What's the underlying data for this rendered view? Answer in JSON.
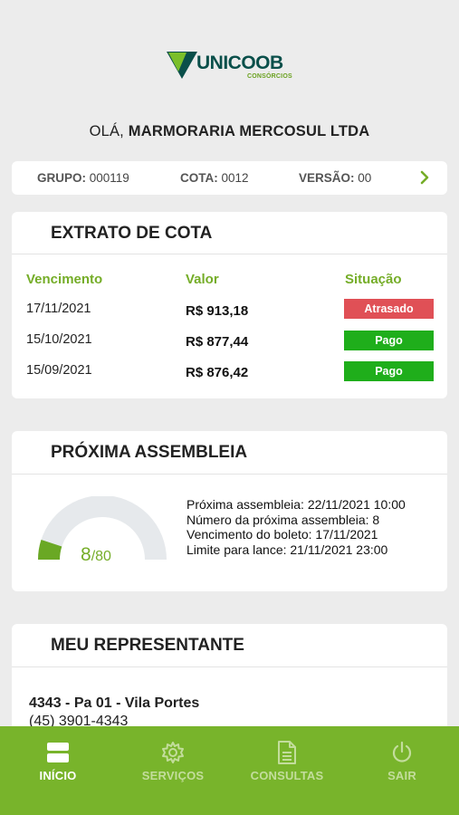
{
  "brand": {
    "name": "UNICOOB",
    "subtitle": "CONSÓRCIOS",
    "colors": {
      "primary": "#0a4f4a",
      "accent": "#78b42b"
    }
  },
  "greeting": {
    "prefix": "OLÁ,",
    "name": "MARMORARIA MERCOSUL LTDA"
  },
  "info_bar": {
    "grupo_label": "GRUPO:",
    "grupo_value": "000119",
    "cota_label": "COTA:",
    "cota_value": "0012",
    "versao_label": "VERSÃO:",
    "versao_value": "00",
    "next_icon": "chevron-right-icon"
  },
  "extrato": {
    "title": "EXTRATO DE COTA",
    "columns": [
      "Vencimento",
      "Valor",
      "Situação"
    ],
    "rows": [
      {
        "date": "17/11/2021",
        "value": "R$ 913,18",
        "status": "Atrasado",
        "status_color": "#e05056"
      },
      {
        "date": "15/10/2021",
        "value": "R$ 877,44",
        "status": "Pago",
        "status_color": "#1fae1b"
      },
      {
        "date": "15/09/2021",
        "value": "R$ 876,42",
        "status": "Pago",
        "status_color": "#1fae1b"
      }
    ]
  },
  "assembleia": {
    "title": "PRÓXIMA ASSEMBLEIA",
    "gauge": {
      "current": "8",
      "total": "/80",
      "fraction": 0.1
    },
    "lines": [
      "Próxima assembleia: 22/11/2021 10:00",
      "Número da próxima assembleia: 8",
      "Vencimento do boleto: 17/11/2021",
      "Limite para lance: 21/11/2021 23:00"
    ]
  },
  "representante": {
    "title": "MEU REPRESENTANTE",
    "name": "4343 - Pa 01 - Vila Portes",
    "phone": "(45) 3901-4343"
  },
  "nav": {
    "items": [
      {
        "label": "INÍCIO",
        "icon": "home-card-icon",
        "active": true
      },
      {
        "label": "SERVIÇOS",
        "icon": "gear-icon",
        "active": false
      },
      {
        "label": "CONSULTAS",
        "icon": "document-icon",
        "active": false
      },
      {
        "label": "SAIR",
        "icon": "power-icon",
        "active": false
      }
    ]
  }
}
